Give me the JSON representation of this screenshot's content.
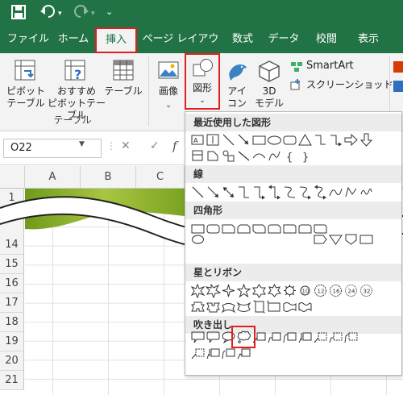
{
  "quick_access": {
    "save_icon": "save-icon",
    "undo_icon": "undo-icon",
    "redo_icon": "redo-icon",
    "customize_icon": "customize-icon"
  },
  "tabs": [
    "ファイル",
    "ホーム",
    "挿入",
    "ページ レイアウト",
    "数式",
    "データ",
    "校閲",
    "表示"
  ],
  "ribbon": {
    "pivot_label": "ピボット\nテーブル",
    "recommended_pivot_label": "おすすめ\nピボットテーブル",
    "table_label": "テーブル",
    "group_table": "テーブル",
    "picture_label": "画像",
    "shapes_label": "図形",
    "icons_label": "アイ\nコン",
    "models_label": "3D\nモデル",
    "smartart_label": "SmartArt",
    "screenshot_label": "スクリーンショット"
  },
  "formula_bar": {
    "name_box": "O22",
    "fx": "f"
  },
  "columns": [
    "A",
    "B",
    "C"
  ],
  "rows": [
    "1",
    "14",
    "15",
    "16",
    "17",
    "18",
    "19",
    "20",
    "21"
  ],
  "shapes_panel": {
    "sections": [
      "最近使用した図形",
      "線",
      "四角形",
      "星とリボン",
      "吹き出し"
    ]
  },
  "colors": {
    "excel_green": "#217346",
    "highlight_red": "#e02020"
  }
}
